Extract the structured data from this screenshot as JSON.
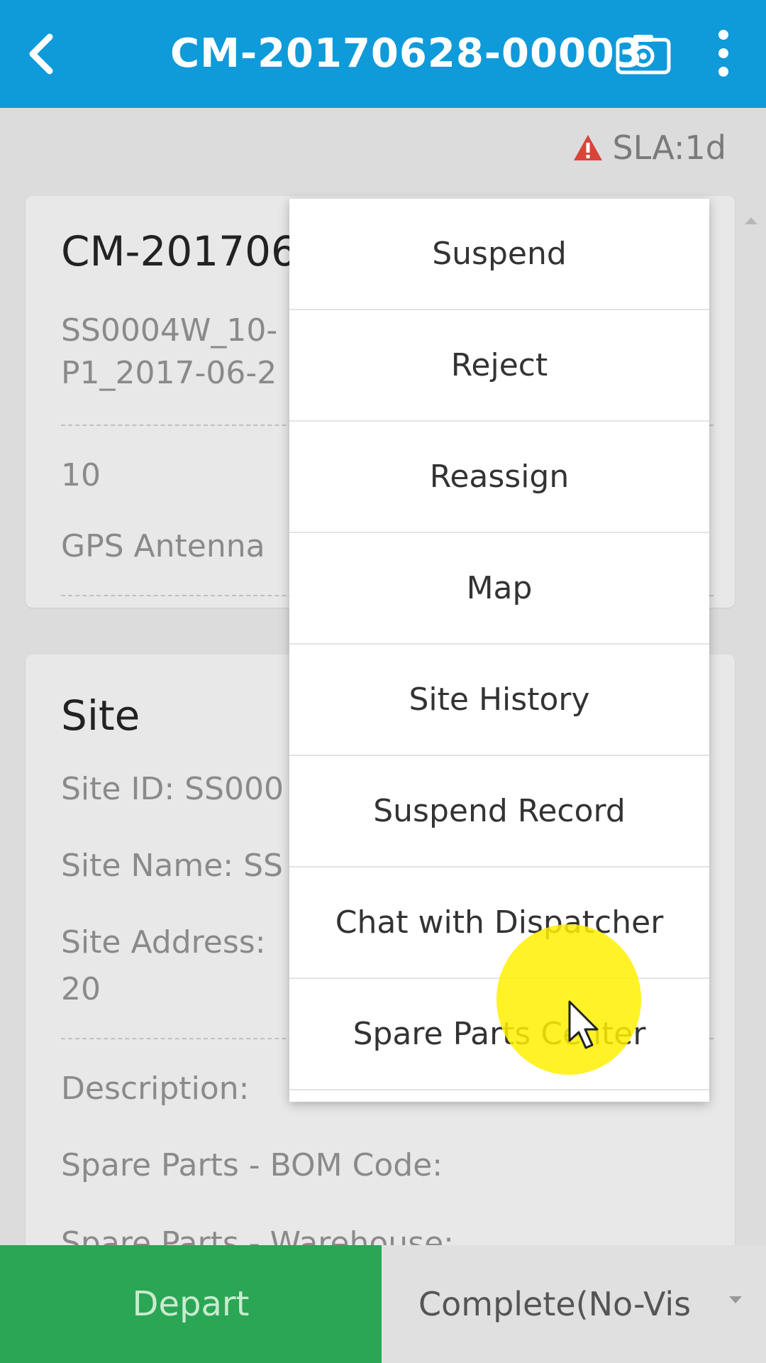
{
  "header": {
    "title": "CM-20170628-00003",
    "back_icon": "chevron-left-icon",
    "camera_icon": "camera-icon",
    "more_icon": "more-vertical-icon",
    "bg_color": "#0f9ad9"
  },
  "sla": {
    "label": "SLA:1d",
    "icon": "warning-icon",
    "icon_color": "#d9443a"
  },
  "ticket_card": {
    "title": "CM-201706",
    "line1": "SS0004W_10-",
    "line2": "P1_2017-06-2",
    "count": "10",
    "equipment": "GPS Antenna"
  },
  "site_card": {
    "title": "Site",
    "site_id": "Site ID: SS000",
    "site_name": "Site Name: SS",
    "site_address": "Site Address:",
    "site_address_cont": "20",
    "description": "Description:",
    "bom_code": "Spare Parts - BOM Code:",
    "warehouse": "Spare Parts - Warehouse:"
  },
  "menu": {
    "items": [
      {
        "label": "Suspend"
      },
      {
        "label": "Reject"
      },
      {
        "label": "Reassign"
      },
      {
        "label": "Map"
      },
      {
        "label": "Site History"
      },
      {
        "label": "Suspend Record"
      },
      {
        "label": "Chat with Dispatcher"
      },
      {
        "label": "Spare Parts Center"
      }
    ]
  },
  "bottom": {
    "depart_label": "Depart",
    "depart_color": "#2aa654",
    "complete_label": "Complete(No-Vis"
  }
}
